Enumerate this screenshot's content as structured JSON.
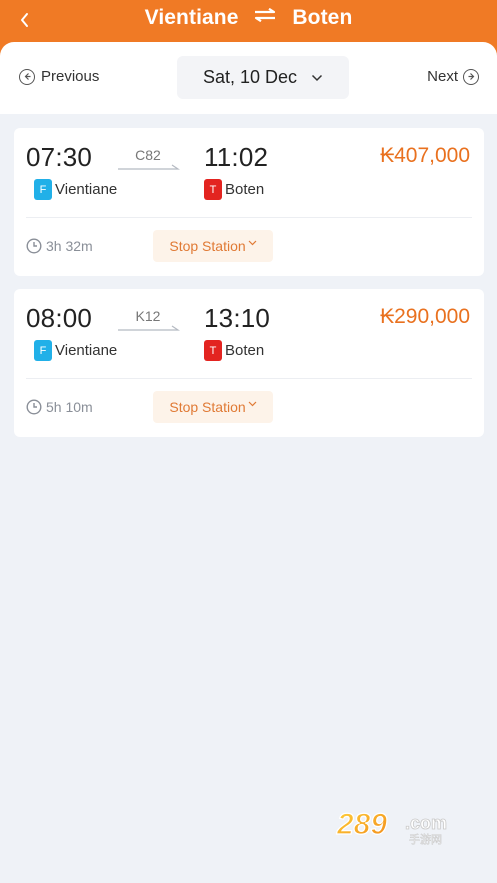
{
  "header": {
    "from": "Vientiane",
    "to": "Boten",
    "back_icon": "chevron-left-icon",
    "swap_icon": "swap-arrows-icon",
    "color": "#f07a25"
  },
  "date_bar": {
    "previous_label": "Previous",
    "next_label": "Next",
    "selected_date": "Sat, 10 Dec"
  },
  "trains": [
    {
      "code": "C82",
      "depart_time": "07:30",
      "arrive_time": "11:02",
      "price": "₭407,000",
      "from_badge": "F",
      "from_station": "Vientiane",
      "to_badge": "T",
      "to_station": "Boten",
      "duration": "3h 32m",
      "stop_label": "Stop Station"
    },
    {
      "code": "K12",
      "depart_time": "08:00",
      "arrive_time": "13:10",
      "price": "₭290,000",
      "from_badge": "F",
      "from_station": "Vientiane",
      "to_badge": "T",
      "to_station": "Boten",
      "duration": "5h 10m",
      "stop_label": "Stop Station"
    }
  ],
  "colors": {
    "accent": "#f07a25",
    "price": "#e9711f",
    "from_badge": "#21b0e8",
    "to_badge": "#e32420"
  },
  "watermark": {
    "text": "289.com",
    "sub": "手游网"
  }
}
